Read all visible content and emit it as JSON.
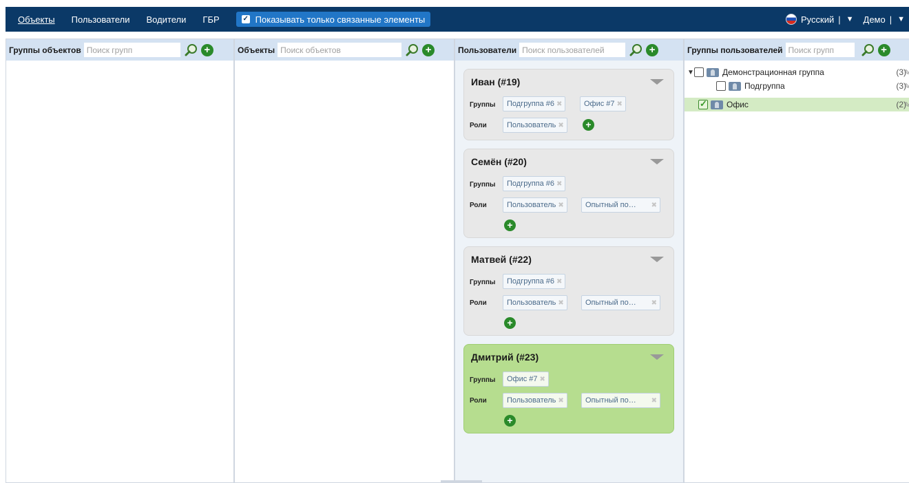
{
  "nav": {
    "items": [
      {
        "label": "Объекты",
        "active": true
      },
      {
        "label": "Пользователи",
        "active": false
      },
      {
        "label": "Водители",
        "active": false
      },
      {
        "label": "ГБР",
        "active": false
      }
    ],
    "toggle_label": "Показывать только связанные элементы",
    "toggle_checked": true,
    "language": "Русский",
    "account": "Демо",
    "separator": "|",
    "dropdown_glyph": "▼"
  },
  "columns": {
    "object_groups": {
      "title": "Группы объектов",
      "search_placeholder": "Поиск групп"
    },
    "objects": {
      "title": "Объекты",
      "search_placeholder": "Поиск объектов"
    },
    "users": {
      "title": "Пользователи",
      "search_placeholder": "Поиск пользователей"
    },
    "user_groups": {
      "title": "Группы пользователей",
      "search_placeholder": "Поиск групп"
    }
  },
  "users": {
    "groups_label": "Группы",
    "roles_label": "Роли",
    "cards": [
      {
        "name": "Иван (#19)",
        "groups": [
          "Подгруппа #6",
          "Офис #7"
        ],
        "roles": [
          "Пользователь"
        ],
        "selected": false
      },
      {
        "name": "Семён (#20)",
        "groups": [
          "Подгруппа #6"
        ],
        "roles": [
          "Пользователь",
          "Опытный по…"
        ],
        "selected": false
      },
      {
        "name": "Матвей (#22)",
        "groups": [
          "Подгруппа #6"
        ],
        "roles": [
          "Пользователь",
          "Опытный по…"
        ],
        "selected": false
      },
      {
        "name": "Дмитрий (#23)",
        "groups": [
          "Офис #7"
        ],
        "roles": [
          "Пользователь",
          "Опытный по…"
        ],
        "selected": true
      }
    ]
  },
  "user_groups_tree": [
    {
      "label": "Демонстрационная группа",
      "count": "(3)",
      "expanded": true,
      "checked": false,
      "level": 0
    },
    {
      "label": "Подгруппа",
      "count": "(3)",
      "checked": false,
      "level": 1
    },
    {
      "label": "Офис",
      "count": "(2)",
      "checked": true,
      "level": 0,
      "selected": true
    }
  ],
  "icons": {
    "remove": "close-icon",
    "search": "search-icon",
    "add": "add-icon",
    "collapse": "chevron-down-icon",
    "edit": "pencil-icon"
  },
  "colors": {
    "topbar": "#0b3967",
    "toggle": "#2176c7",
    "header": "#d4e2f2",
    "selected_card": "#b6dd8f",
    "add_green": "#2a8a2a"
  }
}
